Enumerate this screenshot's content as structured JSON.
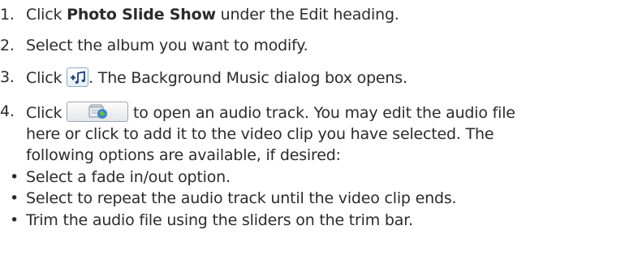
{
  "steps": [
    {
      "number": "1.",
      "pre": "Click ",
      "bold": "Photo Slide Show",
      "post": " under the Edit heading."
    },
    {
      "number": "2.",
      "text": "Select the album you want to modify."
    },
    {
      "number": "3.",
      "pre": "Click ",
      "icon": "add-music-icon",
      "post": ". The Background Music dialog box opens."
    },
    {
      "number": "4.",
      "pre": "Click ",
      "icon": "open-audio-file-icon",
      "post": " to open an audio track. You may edit the audio file",
      "continuation": [
        "here or click to add it to the video clip you have selected. The",
        "following options are available, if desired:"
      ]
    }
  ],
  "bullets": [
    {
      "symbol": "•",
      "text": "Select a fade in/out option."
    },
    {
      "symbol": "•",
      "text": "Select to repeat the audio track until the video clip ends."
    },
    {
      "symbol": "•",
      "text": "Trim the audio file using the sliders on the trim bar."
    }
  ]
}
